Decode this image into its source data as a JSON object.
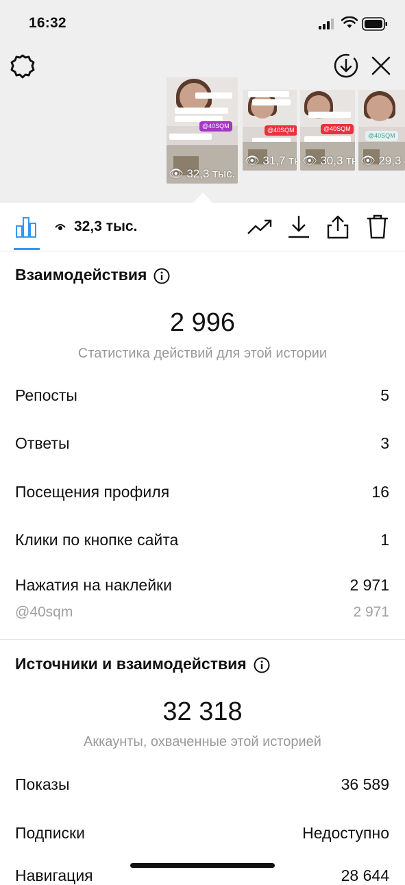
{
  "status_bar": {
    "time": "16:32"
  },
  "stories": [
    {
      "views": "32,3 тыс.",
      "tag": "@40SQM",
      "tag_color": "#a536c8"
    },
    {
      "views": "31,7 ть",
      "tag": "@40SQM",
      "tag_color": "#e8323c"
    },
    {
      "views": "30,3 ть",
      "tag": "@40SQM",
      "tag_color": "#e8323c"
    },
    {
      "views": "29,3",
      "tag": "@40SQM",
      "tag_color": "#3fa69a"
    }
  ],
  "toolbar": {
    "views": "32,3 тыс."
  },
  "interactions": {
    "title": "Взаимодействия",
    "total": "2 996",
    "subtitle": "Статистика действий для этой истории",
    "rows": [
      {
        "label": "Репосты",
        "value": "5"
      },
      {
        "label": "Ответы",
        "value": "3"
      },
      {
        "label": "Посещения профиля",
        "value": "16"
      },
      {
        "label": "Клики по кнопке сайта",
        "value": "1"
      },
      {
        "label": "Нажатия на наклейки",
        "value": "2 971"
      }
    ],
    "sticker_detail": {
      "label": "@40sqm",
      "value": "2 971"
    }
  },
  "discovery": {
    "title": "Источники и взаимодействия",
    "total": "32 318",
    "subtitle": "Аккаунты, охваченные этой историей",
    "rows": [
      {
        "label": "Показы",
        "value": "36 589"
      },
      {
        "label": "Подписки",
        "value": "Недоступно"
      },
      {
        "label": "Навигация",
        "value": "28 644"
      }
    ]
  },
  "colors": {
    "accent": "#3797f0"
  }
}
